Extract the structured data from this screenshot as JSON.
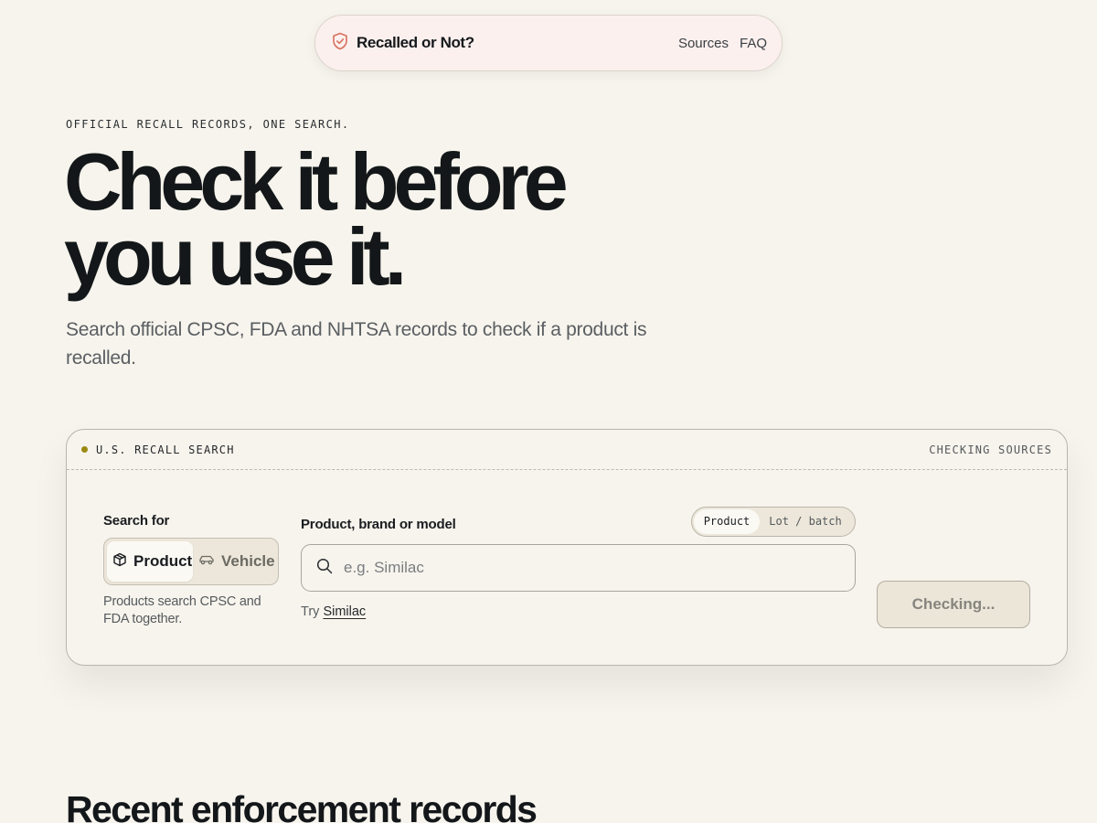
{
  "nav": {
    "brand": "Recalled or Not?",
    "links": [
      "Sources",
      "FAQ"
    ]
  },
  "hero": {
    "eyebrow": "OFFICIAL RECALL RECORDS, ONE SEARCH.",
    "title": "Check it before you use it.",
    "subtitle": "Search official CPSC, FDA and NHTSA records to check if a product is recalled."
  },
  "search_card": {
    "header_label": "U.S. RECALL SEARCH",
    "header_status": "CHECKING SOURCES",
    "search_for_label": "Search for",
    "type_options": [
      "Product",
      "Vehicle"
    ],
    "type_selected": "Product",
    "type_help": "Products search CPSC and FDA together.",
    "query_label": "Product, brand or model",
    "mode_options": [
      "Product",
      "Lot / batch"
    ],
    "mode_selected": "Product",
    "query_value": "",
    "query_placeholder": "e.g. Similac",
    "try_prefix": "Try",
    "try_suggestion": "Similac",
    "submit_label": "Checking..."
  },
  "recent": {
    "heading": "Recent enforcement records"
  },
  "colors": {
    "background": "#f7f4ed",
    "nav_background": "#fbf0ee",
    "status_dot": "#9a8a12",
    "shield_icon": "#d8705e",
    "text_primary": "#14171a"
  }
}
